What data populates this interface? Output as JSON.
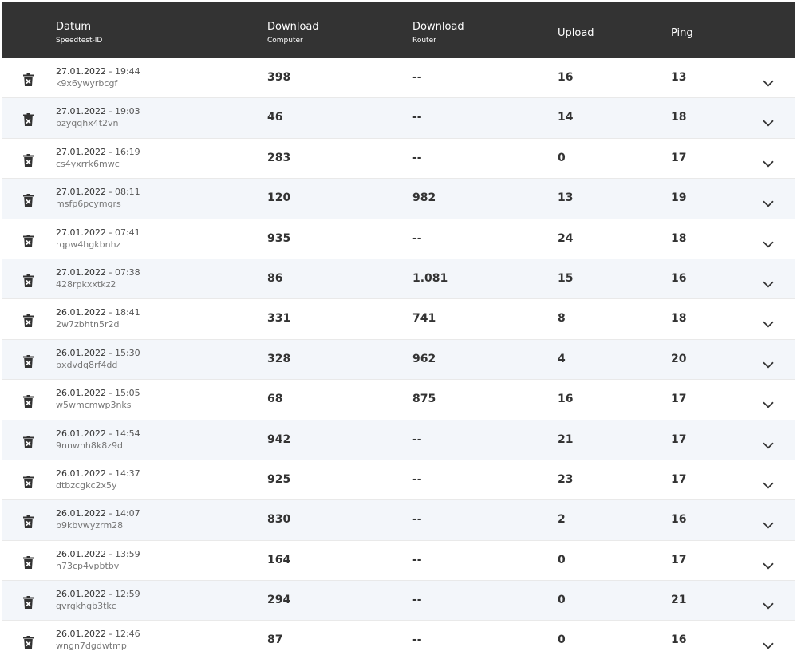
{
  "header": {
    "datum_label": "Datum",
    "datum_sub": "Speedtest-ID",
    "download_computer_label": "Download",
    "download_computer_sub": "Computer",
    "download_router_label": "Download",
    "download_router_sub": "Router",
    "upload_label": "Upload",
    "ping_label": "Ping"
  },
  "colors": {
    "header_bg": "#333333",
    "row_alt_bg": "#f3f6fa",
    "text": "#333333"
  },
  "icons": {
    "delete": "trash-icon",
    "expand": "chevron-down-icon"
  },
  "rows": [
    {
      "date": "27.01.2022",
      "time": "19:44",
      "id": "k9x6ywyrbcgf",
      "download_computer": "398",
      "download_router": "--",
      "upload": "16",
      "ping": "13"
    },
    {
      "date": "27.01.2022",
      "time": "19:03",
      "id": "bzyqqhx4t2vn",
      "download_computer": "46",
      "download_router": "--",
      "upload": "14",
      "ping": "18"
    },
    {
      "date": "27.01.2022",
      "time": "16:19",
      "id": "cs4yxrrk6mwc",
      "download_computer": "283",
      "download_router": "--",
      "upload": "0",
      "ping": "17"
    },
    {
      "date": "27.01.2022",
      "time": "08:11",
      "id": "msfp6pcymqrs",
      "download_computer": "120",
      "download_router": "982",
      "upload": "13",
      "ping": "19"
    },
    {
      "date": "27.01.2022",
      "time": "07:41",
      "id": "rqpw4hgkbnhz",
      "download_computer": "935",
      "download_router": "--",
      "upload": "24",
      "ping": "18"
    },
    {
      "date": "27.01.2022",
      "time": "07:38",
      "id": "428rpkxxtkz2",
      "download_computer": "86",
      "download_router": "1.081",
      "upload": "15",
      "ping": "16"
    },
    {
      "date": "26.01.2022",
      "time": "18:41",
      "id": "2w7zbhtn5r2d",
      "download_computer": "331",
      "download_router": "741",
      "upload": "8",
      "ping": "18"
    },
    {
      "date": "26.01.2022",
      "time": "15:30",
      "id": "pxdvdq8rf4dd",
      "download_computer": "328",
      "download_router": "962",
      "upload": "4",
      "ping": "20"
    },
    {
      "date": "26.01.2022",
      "time": "15:05",
      "id": "w5wmcmwp3nks",
      "download_computer": "68",
      "download_router": "875",
      "upload": "16",
      "ping": "17"
    },
    {
      "date": "26.01.2022",
      "time": "14:54",
      "id": "9nnwnh8k8z9d",
      "download_computer": "942",
      "download_router": "--",
      "upload": "21",
      "ping": "17"
    },
    {
      "date": "26.01.2022",
      "time": "14:37",
      "id": "dtbzcgkc2x5y",
      "download_computer": "925",
      "download_router": "--",
      "upload": "23",
      "ping": "17"
    },
    {
      "date": "26.01.2022",
      "time": "14:07",
      "id": "p9kbvwyzrm28",
      "download_computer": "830",
      "download_router": "--",
      "upload": "2",
      "ping": "16"
    },
    {
      "date": "26.01.2022",
      "time": "13:59",
      "id": "n73cp4vpbtbv",
      "download_computer": "164",
      "download_router": "--",
      "upload": "0",
      "ping": "17"
    },
    {
      "date": "26.01.2022",
      "time": "12:59",
      "id": "qvrgkhgb3tkc",
      "download_computer": "294",
      "download_router": "--",
      "upload": "0",
      "ping": "21"
    },
    {
      "date": "26.01.2022",
      "time": "12:46",
      "id": "wngn7dgdwtmp",
      "download_computer": "87",
      "download_router": "--",
      "upload": "0",
      "ping": "16"
    }
  ]
}
